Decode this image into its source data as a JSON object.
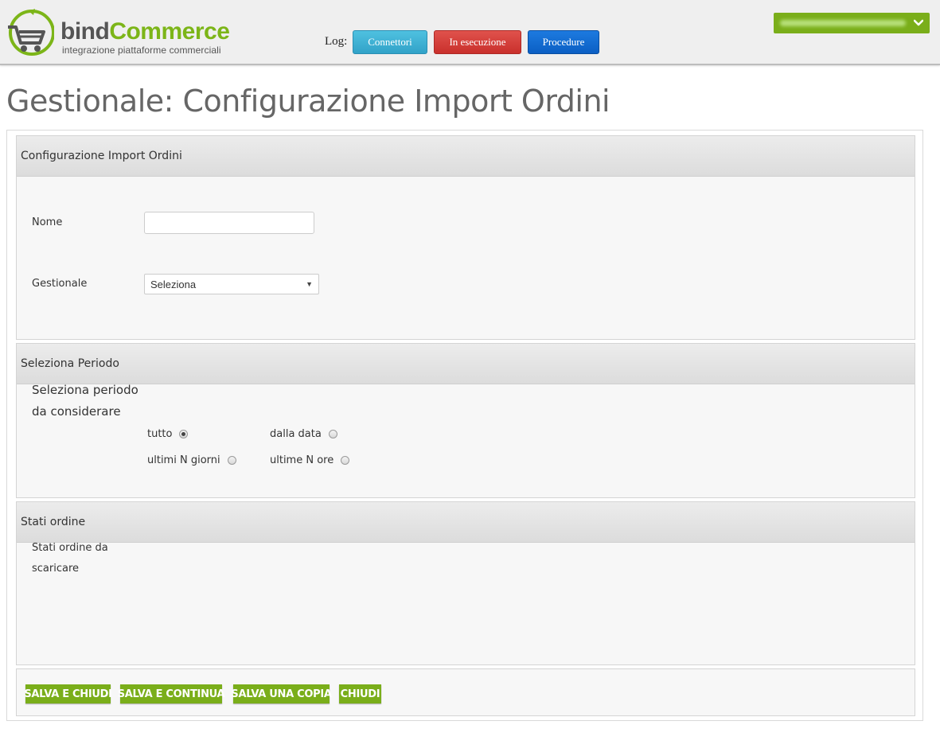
{
  "header": {
    "logo": {
      "brand_part1": "bind",
      "brand_part2": "Commerce",
      "tagline": "integrazione piattaforme commerciali",
      "accent_color": "#7cb518"
    },
    "log_label": "Log:",
    "log_buttons": [
      {
        "label": "Connettori",
        "color": "#31a2c8"
      },
      {
        "label": "In esecuzione",
        "color": "#d9534f"
      },
      {
        "label": "Procedure",
        "color": "#0b5fc4"
      }
    ],
    "user_menu": {
      "icon": "chevron-down-icon",
      "color": "#7aae1a"
    }
  },
  "page": {
    "title": "Gestionale: Configurazione Import Ordini"
  },
  "sections": {
    "config": {
      "title": "Configurazione Import Ordini",
      "nome_label": "Nome",
      "nome_value": "",
      "gestionale_label": "Gestionale",
      "gestionale_selected": "Seleziona"
    },
    "periodo": {
      "title": "Seleziona Periodo",
      "label_line1": "Seleziona periodo",
      "label_line2": "da considerare",
      "options": [
        {
          "label": "tutto",
          "checked": true
        },
        {
          "label": "dalla data",
          "checked": false
        },
        {
          "label": "ultimi N giorni",
          "checked": false
        },
        {
          "label": "ultime N ore",
          "checked": false
        }
      ]
    },
    "stati": {
      "title": "Stati ordine",
      "label_line1": "Stati ordine da",
      "label_line2": "scaricare"
    }
  },
  "actions": {
    "save_close": "SALVA E CHIUDI",
    "save_continue": "SALVA E CONTINUA",
    "save_copy": "SALVA UNA COPIA",
    "close": "CHIUDI",
    "color": "#7aae1a"
  }
}
